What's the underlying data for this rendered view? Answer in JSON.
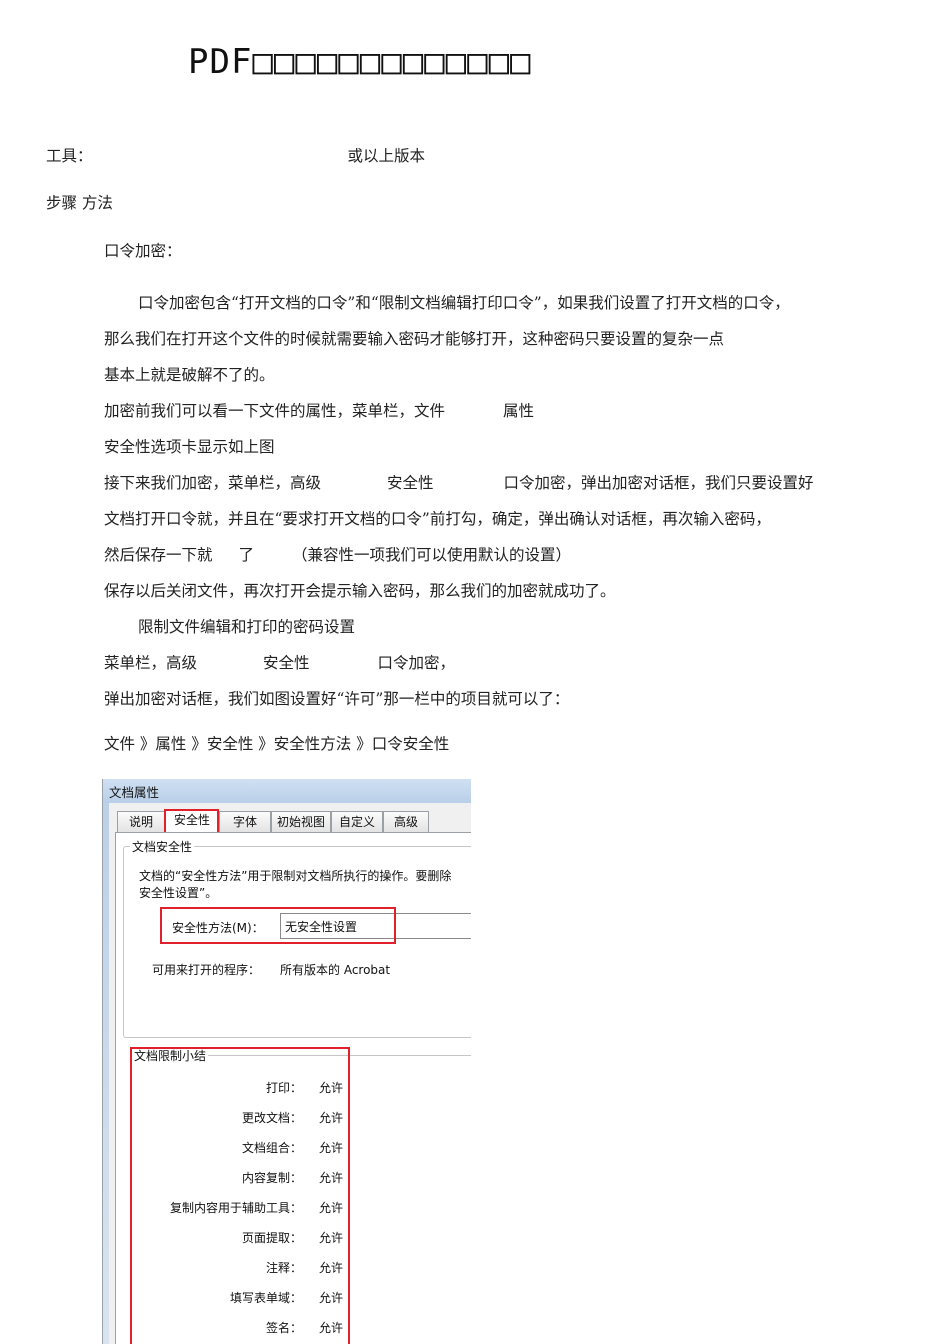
{
  "title": "PDF□□□□□□□□□□□□□",
  "tools": {
    "label": "工具：",
    "suffix": "或以上版本"
  },
  "steps_heading": "步骤  方法",
  "section1": "口令加密：",
  "paragraphs": {
    "p1a": "口令加密包含“打开文档的口令”和“限制文档编辑打印口令”，如果我们设置了打开文档的口令，",
    "p1b": "那么我们在打开这个文件的时候就需要输入密码才能够打开，这种密码只要设置的复杂一点",
    "p1c": "基本上就是破解不了的。",
    "p2a": "加密前我们可以看一下文件的属性，菜单栏，文件",
    "p2b": "属性",
    "p3": "安全性选项卡显示如上图",
    "p4a": "接下来我们加密，菜单栏，高级",
    "p4b": "安全性",
    "p4c": "口令加密，弹出加密对话框，我们只要设置好",
    "p5": "文档打开口令就，并且在“要求打开文档的口令”前打勾，确定，弹出确认对话框，再次输入密码，",
    "p6a": "然后保存一下就",
    "p6b": "了",
    "p6c": "（兼容性一项我们可以使用默认的设置）",
    "p7": "保存以后关闭文件，再次打开会提示输入密码，那么我们的加密就成功了。",
    "p8": "限制文件编辑和打印的密码设置",
    "p9a": "菜单栏，高级",
    "p9b": "安全性",
    "p9c": "口令加密，",
    "p10": "弹出加密对话框，我们如图设置好“许可”那一栏中的项目就可以了：",
    "p11": "文件 》属性 》安全性 》安全性方法 》口令安全性"
  },
  "dialog": {
    "title": "文档属性",
    "tabs": [
      "说明",
      "安全性",
      "字体",
      "初始视图",
      "自定义",
      "高级"
    ],
    "security_group": "文档安全性",
    "description_line1": "文档的“安全性方法”用于限制对文档所执行的操作。要删除",
    "description_line2": "安全性设置”。",
    "method_label": "安全性方法(M)：",
    "method_value": "无安全性设置",
    "programs_label": "可用来打开的程序：",
    "programs_value": "所有版本的 Acrobat",
    "restrictions_group": "文档限制小结",
    "restrictions": [
      {
        "label": "打印：",
        "value": "允许"
      },
      {
        "label": "更改文档：",
        "value": "允许"
      },
      {
        "label": "文档组合：",
        "value": "允许"
      },
      {
        "label": "内容复制：",
        "value": "允许"
      },
      {
        "label": "复制内容用于辅助工具：",
        "value": "允许"
      },
      {
        "label": "页面提取：",
        "value": "允许"
      },
      {
        "label": "注释：",
        "value": "允许"
      },
      {
        "label": "填写表单域：",
        "value": "允许"
      },
      {
        "label": "签名：",
        "value": "允许"
      }
    ]
  },
  "colors": {
    "highlight": "#e0202a",
    "titlebar": "#c4d7ee"
  }
}
